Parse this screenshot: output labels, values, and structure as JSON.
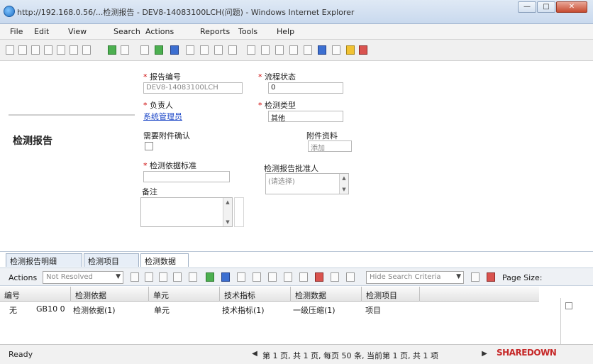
{
  "window": {
    "title": "http://192.168.0.56/...检测报告 - DEV8-14083100LCH(问题) - Windows Internet Explorer",
    "min": "—",
    "max": "□",
    "close": "✕"
  },
  "menu": [
    "File",
    "Edit",
    "View",
    "Search",
    "Actions",
    "Reports",
    "Tools",
    "Help"
  ],
  "form": {
    "section_title": "检测报告",
    "fields": {
      "report_no_label": "报告编号",
      "report_no_value": "DEV8-14083100LCH",
      "status_label": "流程状态",
      "status_value": "0",
      "owner_label": "负责人",
      "owner_link": "系统管理员",
      "category_label": "检测类型",
      "category_value": "其他",
      "check_label": "需要附件确认",
      "attach_label": "附件资料",
      "attach_placeholder": "添加",
      "standard_label": "检测依据标准",
      "approver_label": "检测报告批准人",
      "approver_placeholder": "(请选择)",
      "remark_label": "备注"
    }
  },
  "grid": {
    "tabs": [
      "检测报告明细",
      "检测项目",
      "检测数据"
    ],
    "active_tab": 2,
    "toolbar": {
      "actions_label": "Actions",
      "scope_value": "Not Resolved",
      "hide_criteria": "Hide Search Criteria",
      "page_size_label": "Page Size:"
    },
    "columns": [
      "编号",
      "检测依据",
      "单元",
      "技术指标",
      "检测数据",
      "检测项目"
    ],
    "rows": [
      [
        "无",
        "GB10 0",
        "检测依据(1)",
        "单元",
        "技术指标(1)",
        "一级压缩(1)",
        "项目"
      ]
    ]
  },
  "status": {
    "ready": "Ready",
    "pager": "第 1 页, 共 1 页, 每页 50 条, 当前第 1 页, 共 1 项",
    "brand": "SHAREDOWN"
  }
}
